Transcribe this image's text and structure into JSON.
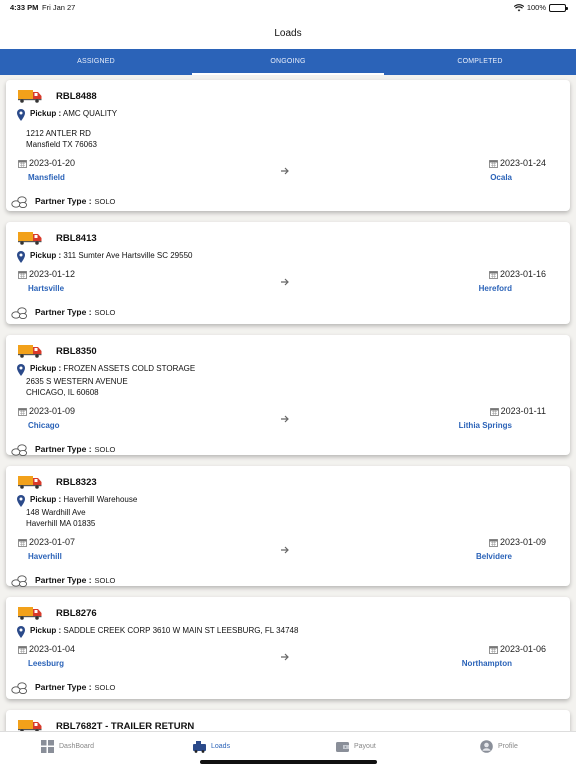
{
  "status_bar": {
    "time": "4:33 PM",
    "date": "Fri Jan 27",
    "battery": "100%"
  },
  "header": {
    "title": "Loads"
  },
  "tabs": [
    {
      "label": "ASSIGNED",
      "active": false
    },
    {
      "label": "ONGOING",
      "active": true
    },
    {
      "label": "COMPLETED",
      "active": false
    }
  ],
  "loads": [
    {
      "id": "RBL8488",
      "pickup_label": "Pickup :",
      "pickup_name": "AMC QUALITY",
      "address_lines": [
        "1212 ANTLER RD",
        "Mansfield TX 76063"
      ],
      "start_date": "2023-01-20",
      "origin": "Mansfield",
      "end_date": "2023-01-24",
      "destination": "Ocala",
      "partner_label": "Partner Type :",
      "partner_type": "SOLO"
    },
    {
      "id": "RBL8413",
      "pickup_label": "Pickup :",
      "pickup_name": "311 Sumter Ave Hartsville SC 29550",
      "address_lines": [],
      "start_date": "2023-01-12",
      "origin": "Hartsville",
      "end_date": "2023-01-16",
      "destination": "Hereford",
      "partner_label": "Partner Type :",
      "partner_type": "SOLO"
    },
    {
      "id": "RBL8350",
      "pickup_label": "Pickup :",
      "pickup_name": "FROZEN ASSETS COLD STORAGE",
      "address_lines": [
        "2635 S WESTERN AVENUE",
        "CHICAGO, IL 60608"
      ],
      "start_date": "2023-01-09",
      "origin": "Chicago",
      "end_date": "2023-01-11",
      "destination": "Lithia Springs",
      "partner_label": "Partner Type :",
      "partner_type": "SOLO"
    },
    {
      "id": "RBL8323",
      "pickup_label": "Pickup :",
      "pickup_name": "Haverhill Warehouse",
      "address_lines": [
        "148 Wardhill Ave",
        "Haverhill MA 01835"
      ],
      "start_date": "2023-01-07",
      "origin": "Haverhill",
      "end_date": "2023-01-09",
      "destination": "Belvidere",
      "partner_label": "Partner Type :",
      "partner_type": "SOLO"
    },
    {
      "id": "RBL8276",
      "pickup_label": "Pickup :",
      "pickup_name": "SADDLE CREEK CORP 3610 W MAIN ST LEESBURG, FL 34748",
      "address_lines": [],
      "start_date": "2023-01-04",
      "origin": "Leesburg",
      "end_date": "2023-01-06",
      "destination": "Northampton",
      "partner_label": "Partner Type :",
      "partner_type": "SOLO"
    },
    {
      "id": "RBL7682T - TRAILER RETURN"
    }
  ],
  "tabbar": [
    {
      "label": "DashBoard",
      "icon": "dashboard-icon",
      "active": false
    },
    {
      "label": "Loads",
      "icon": "truck-icon",
      "active": true
    },
    {
      "label": "Payout",
      "icon": "wallet-icon",
      "active": false
    },
    {
      "label": "Profile",
      "icon": "profile-icon",
      "active": false
    }
  ],
  "colors": {
    "accent": "#2b63b8",
    "truck": "#f2a11a",
    "truck_body": "#d83a2a"
  }
}
